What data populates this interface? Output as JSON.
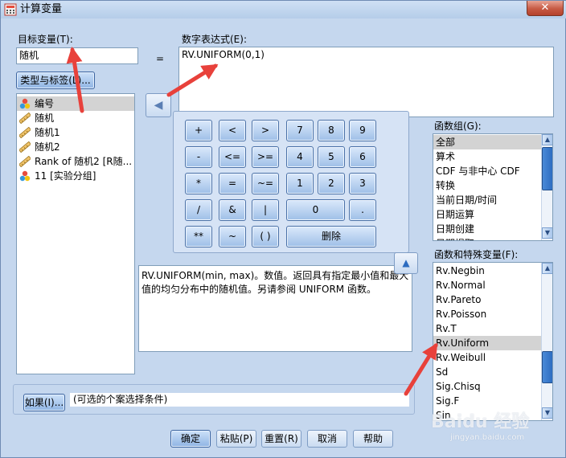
{
  "window": {
    "title": "计算变量",
    "close_glyph": "✕"
  },
  "target": {
    "label": "目标变量(T):",
    "value": "随机",
    "type_label_button": "类型与标签(L)..."
  },
  "equals": "=",
  "expression": {
    "label": "数字表达式(E):",
    "value": "RV.UNIFORM(0,1)"
  },
  "move_button_glyph": "◀",
  "variables": [
    {
      "icon": "nominal",
      "label": "编号",
      "selected": true
    },
    {
      "icon": "scale",
      "label": "随机",
      "selected": false
    },
    {
      "icon": "scale",
      "label": "随机1",
      "selected": false
    },
    {
      "icon": "scale",
      "label": "随机2",
      "selected": false
    },
    {
      "icon": "scale",
      "label": "Rank of 随机2 [R随...",
      "selected": false
    },
    {
      "icon": "nominal",
      "label": "11 [实验分组]",
      "selected": false
    }
  ],
  "keypad": {
    "rows": [
      [
        "+",
        "<",
        ">",
        "7",
        "8",
        "9"
      ],
      [
        "-",
        "<=",
        ">=",
        "4",
        "5",
        "6"
      ],
      [
        "*",
        "=",
        "~=",
        "1",
        "2",
        "3"
      ],
      [
        "/",
        "&",
        "|",
        "0",
        "."
      ],
      [
        "**",
        "~",
        "( )",
        "删除"
      ]
    ]
  },
  "function_groups": {
    "label": "函数组(G):",
    "items": [
      "全部",
      "算术",
      "CDF 与非中心 CDF",
      "转换",
      "当前日期/时间",
      "日期运算",
      "日期创建",
      "日期提取"
    ],
    "selected_index": 0
  },
  "functions": {
    "label": "函数和特殊变量(F):",
    "items": [
      "Rv.Negbin",
      "Rv.Normal",
      "Rv.Pareto",
      "Rv.Poisson",
      "Rv.T",
      "Rv.Uniform",
      "Rv.Weibull",
      "Sd",
      "Sig.Chisq",
      "Sig.F",
      "Sin"
    ],
    "selected_index": 5
  },
  "insert_button_glyph": "▲",
  "description": "RV.UNIFORM(min, max)。数值。返回具有指定最小值和最大值的均匀分布中的随机值。另请参阅 UNIFORM 函数。",
  "condition": {
    "if_button": "如果(I)...",
    "text": "(可选的个案选择条件)"
  },
  "buttons": {
    "ok": "确定",
    "paste": "粘贴(P)",
    "reset": "重置(R)",
    "cancel": "取消",
    "help": "帮助"
  },
  "watermark": {
    "text": "Baidu 经验",
    "subtext": "jingyan.baidu.com"
  },
  "colors": {
    "annotation_arrow": "#e8413b",
    "selection": "#d3d3d3",
    "scrollbar_thumb": "#2d6cc0"
  }
}
